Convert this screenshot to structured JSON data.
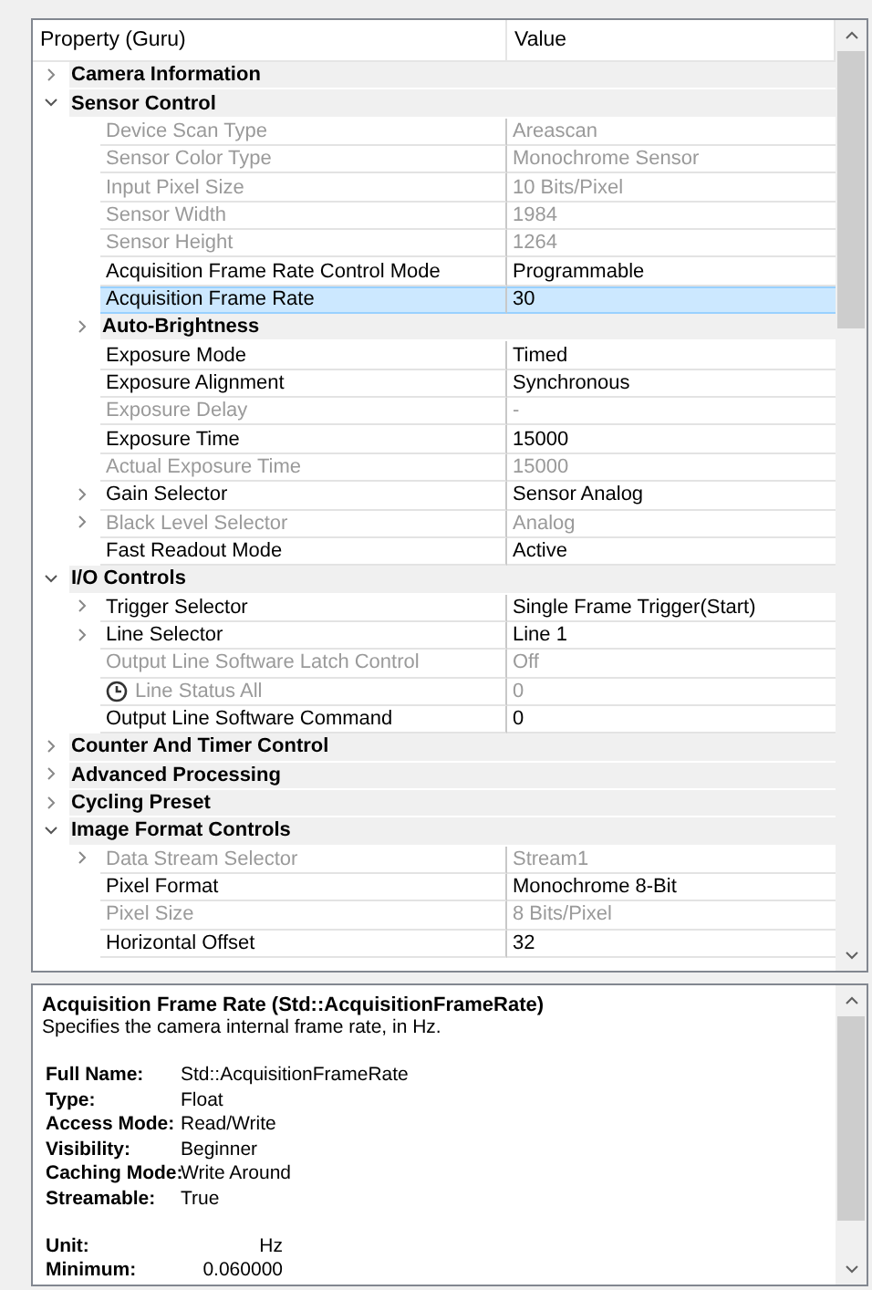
{
  "grid": {
    "columns": [
      "Property (Guru)",
      "Value"
    ],
    "rows": [
      {
        "kind": "group",
        "name": "Camera Information",
        "expanded": false
      },
      {
        "kind": "group",
        "name": "Sensor Control",
        "expanded": true,
        "children": [
          {
            "kind": "property",
            "name": "Device Scan Type",
            "value": "Areascan",
            "disabled": true,
            "selected": false
          },
          {
            "kind": "property",
            "name": "Sensor Color Type",
            "value": "Monochrome Sensor",
            "disabled": true,
            "selected": false
          },
          {
            "kind": "property",
            "name": "Input Pixel Size",
            "value": "10 Bits/Pixel",
            "disabled": true,
            "selected": false
          },
          {
            "kind": "property",
            "name": "Sensor Width",
            "value": "1984",
            "disabled": true,
            "selected": false
          },
          {
            "kind": "property",
            "name": "Sensor Height",
            "value": "1264",
            "disabled": true,
            "selected": false
          },
          {
            "kind": "property",
            "name": "Acquisition Frame Rate Control Mode",
            "value": "Programmable",
            "disabled": false,
            "selected": false
          },
          {
            "kind": "property",
            "name": "Acquisition Frame Rate",
            "value": "30",
            "disabled": false,
            "selected": true
          },
          {
            "kind": "group",
            "name": "Auto-Brightness",
            "expanded": false
          },
          {
            "kind": "property",
            "name": "Exposure Mode",
            "value": "Timed",
            "disabled": false,
            "selected": false
          },
          {
            "kind": "property",
            "name": "Exposure Alignment",
            "value": "Synchronous",
            "disabled": false,
            "selected": false
          },
          {
            "kind": "property",
            "name": "Exposure Delay",
            "value": "-",
            "disabled": true,
            "selected": false
          },
          {
            "kind": "property",
            "name": "Exposure Time",
            "value": "15000",
            "disabled": false,
            "selected": false
          },
          {
            "kind": "property",
            "name": "Actual Exposure Time",
            "value": "15000",
            "disabled": true,
            "selected": false
          },
          {
            "kind": "property",
            "name": "Gain Selector",
            "value": "Sensor Analog",
            "disabled": false,
            "selected": false,
            "expanded": false
          },
          {
            "kind": "property",
            "name": "Black Level Selector",
            "value": "Analog",
            "disabled": true,
            "selected": false,
            "expanded": false
          },
          {
            "kind": "property",
            "name": "Fast Readout Mode",
            "value": "Active",
            "disabled": false,
            "selected": false
          }
        ]
      },
      {
        "kind": "group",
        "name": "I/O Controls",
        "expanded": true,
        "children": [
          {
            "kind": "property",
            "name": "Trigger Selector",
            "value": "Single Frame Trigger(Start)",
            "disabled": false,
            "selected": false,
            "expanded": false
          },
          {
            "kind": "property",
            "name": "Line Selector",
            "value": "Line 1",
            "disabled": false,
            "selected": false,
            "expanded": false
          },
          {
            "kind": "property",
            "name": "Output Line Software Latch Control",
            "value": "Off",
            "disabled": true,
            "selected": false
          },
          {
            "kind": "polled",
            "name": "Line Status All",
            "value": "0",
            "disabled": true,
            "selected": false
          },
          {
            "kind": "property",
            "name": "Output Line Software Command",
            "value": "0",
            "disabled": false,
            "selected": false
          }
        ]
      },
      {
        "kind": "group",
        "name": "Counter And Timer Control",
        "expanded": false
      },
      {
        "kind": "group",
        "name": "Advanced Processing",
        "expanded": false
      },
      {
        "kind": "group",
        "name": "Cycling Preset",
        "expanded": false
      },
      {
        "kind": "group",
        "name": "Image Format Controls",
        "expanded": true,
        "children": [
          {
            "kind": "property",
            "name": "Data Stream Selector",
            "value": "Stream1",
            "disabled": true,
            "selected": false,
            "expanded": false
          },
          {
            "kind": "property",
            "name": "Pixel Format",
            "value": "Monochrome 8-Bit",
            "disabled": false,
            "selected": false
          },
          {
            "kind": "property",
            "name": "Pixel Size",
            "value": "8 Bits/Pixel",
            "disabled": true,
            "selected": false
          },
          {
            "kind": "property",
            "name": "Horizontal Offset",
            "value": "32",
            "disabled": false,
            "selected": false
          }
        ]
      }
    ]
  },
  "description": {
    "title": "Acquisition Frame Rate (Std::AcquisitionFrameRate)",
    "summary": "Specifies the camera internal frame rate, in Hz.",
    "details": [
      {
        "label": "Full Name:",
        "value": "Std::AcquisitionFrameRate"
      },
      {
        "label": "Type:",
        "value": "Float"
      },
      {
        "label": "Access Mode:",
        "value": "Read/Write"
      },
      {
        "label": "Visibility:",
        "value": "Beginner"
      },
      {
        "label": "Caching Mode:",
        "value": "Write Around"
      },
      {
        "label": "Streamable:",
        "value": "True"
      }
    ],
    "limits": [
      {
        "label": "Unit:",
        "value": "Hz"
      },
      {
        "label": "Minimum:",
        "value": "0.060000"
      }
    ]
  }
}
